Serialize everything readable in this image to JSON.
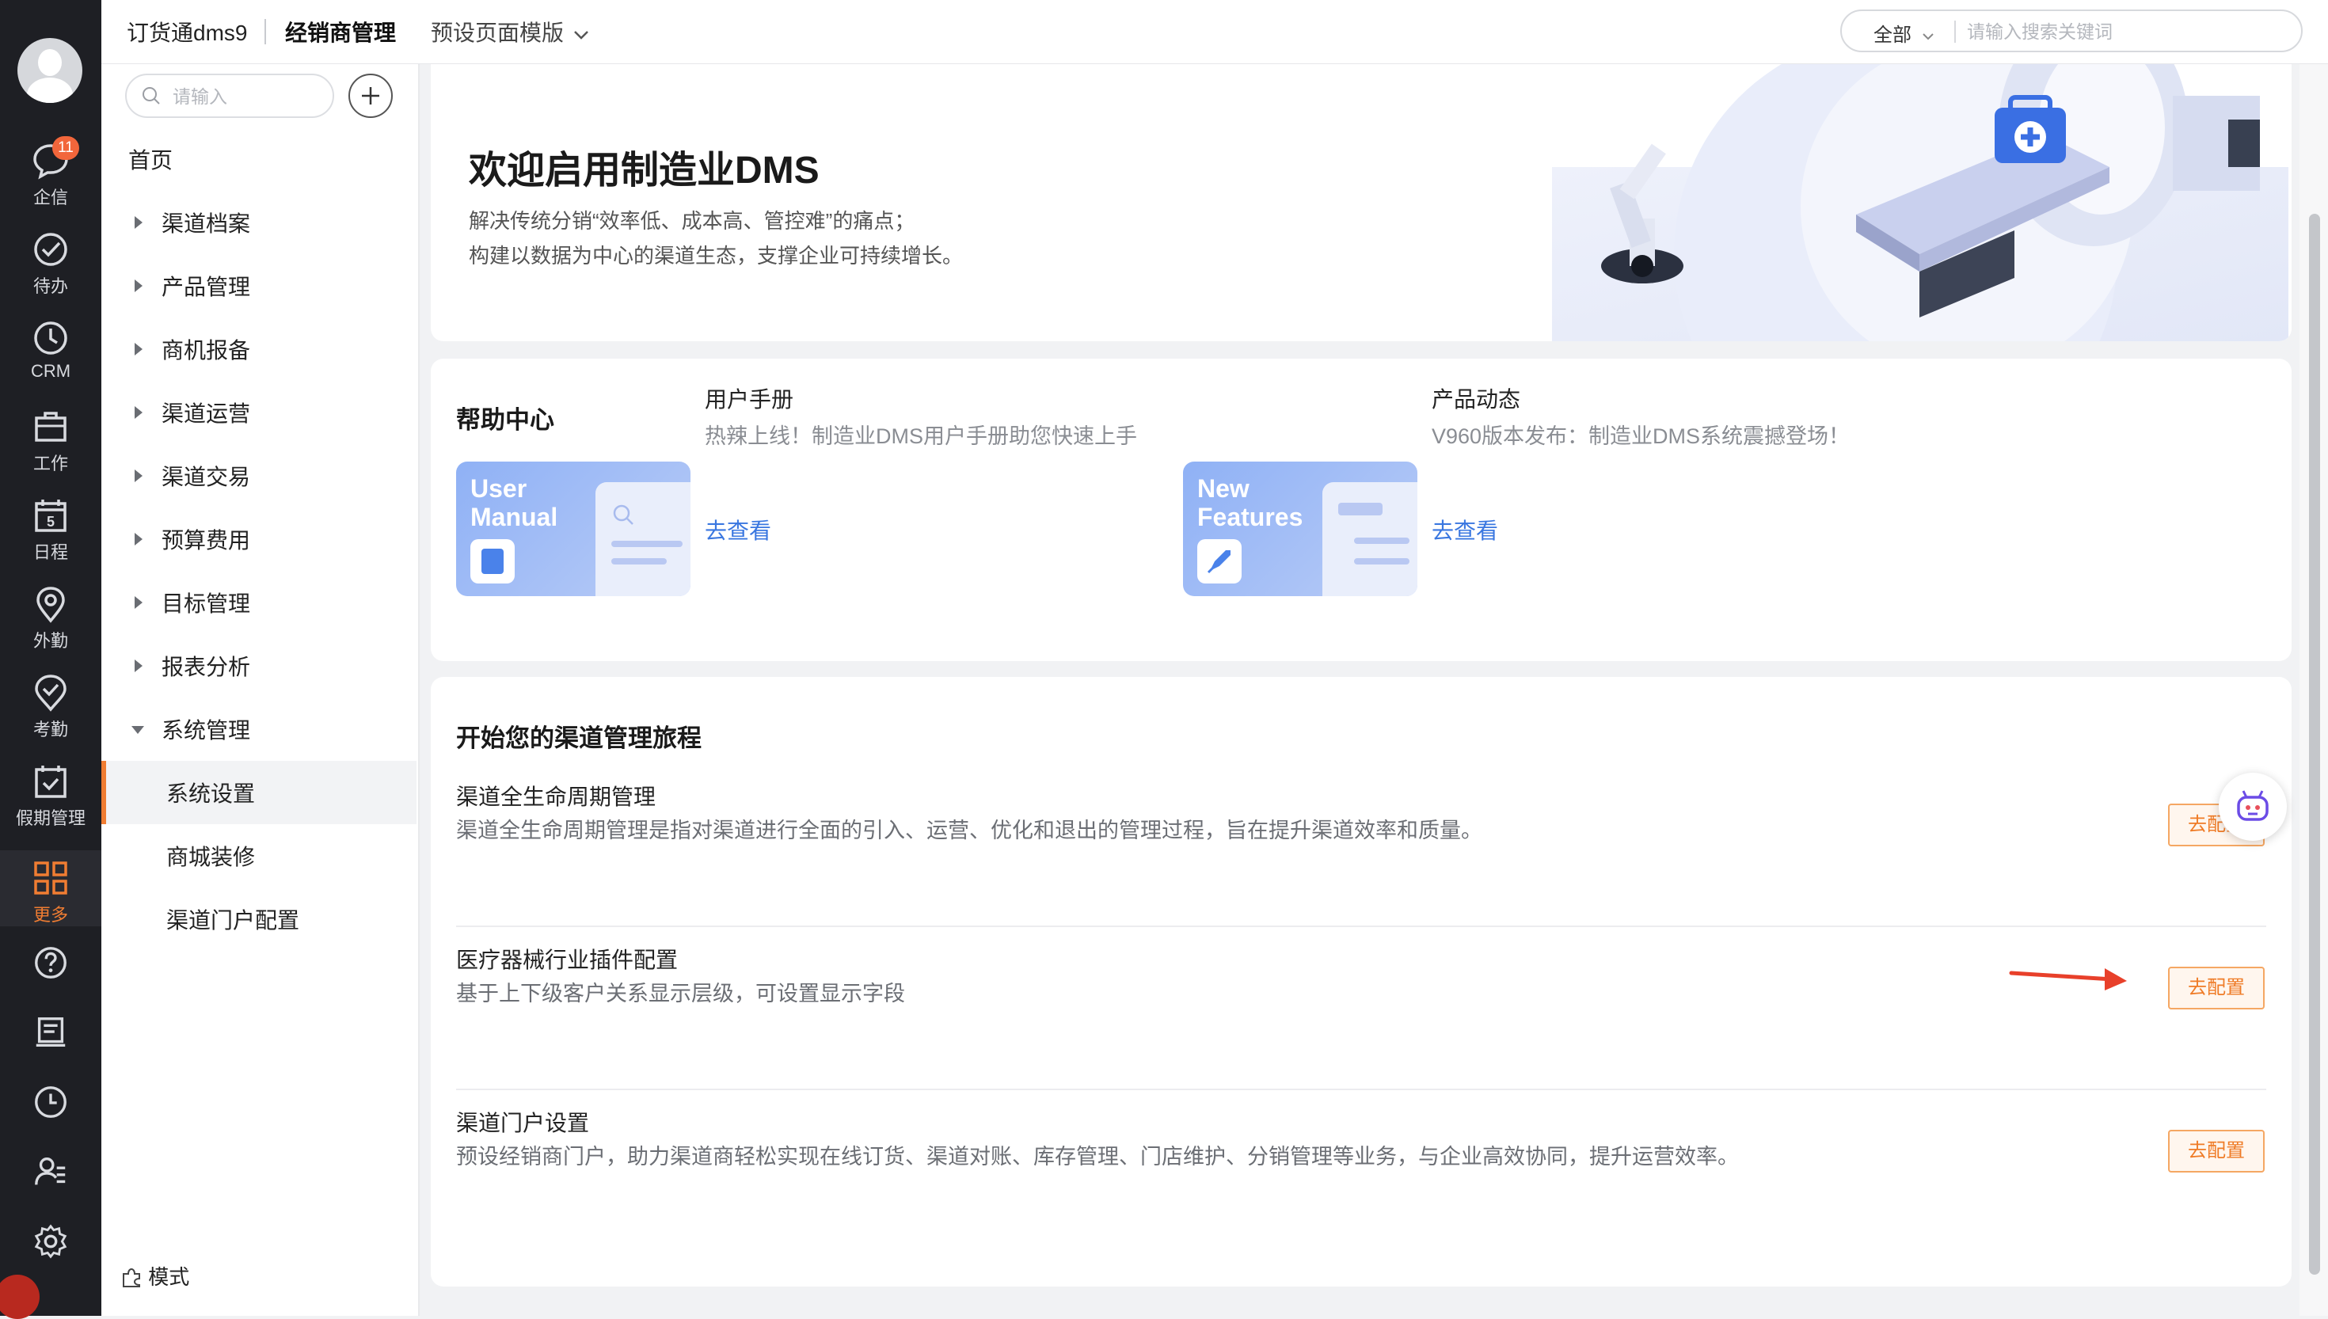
{
  "rail": {
    "items": [
      {
        "label": "企信",
        "icon": "chat-bubble-icon",
        "badge": "11"
      },
      {
        "label": "待办",
        "icon": "check-circle-icon"
      },
      {
        "label": "CRM",
        "icon": "clock-icon"
      },
      {
        "label": "工作",
        "icon": "briefcase-icon"
      },
      {
        "label": "日程",
        "icon": "calendar-icon",
        "day": "5"
      },
      {
        "label": "外勤",
        "icon": "location-pin-icon"
      },
      {
        "label": "考勤",
        "icon": "attendance-check-icon"
      },
      {
        "label": "假期管理",
        "icon": "leave-calendar-icon"
      },
      {
        "label": "更多",
        "icon": "grid-more-icon",
        "active": true
      }
    ],
    "bottom_icons": [
      "help-icon",
      "document-icon",
      "history-icon",
      "user-manage-icon",
      "settings-gear-icon"
    ]
  },
  "topbar": {
    "app_name": "订货通dms9",
    "title": "经销商管理",
    "template_label": "预设页面模版",
    "search_scope": "全部",
    "search_placeholder": "请输入搜索关键词"
  },
  "nav": {
    "search_placeholder": "请输入",
    "home": "首页",
    "groups": [
      {
        "label": "渠道档案"
      },
      {
        "label": "产品管理"
      },
      {
        "label": "商机报备"
      },
      {
        "label": "渠道运营"
      },
      {
        "label": "渠道交易"
      },
      {
        "label": "预算费用"
      },
      {
        "label": "目标管理"
      },
      {
        "label": "报表分析"
      },
      {
        "label": "系统管理",
        "expanded": true
      }
    ],
    "sub_items": [
      {
        "label": "系统设置",
        "active": true
      },
      {
        "label": "商城装修"
      },
      {
        "label": "渠道门户配置"
      }
    ],
    "mode_label": "模式"
  },
  "banner": {
    "title": "欢迎启用制造业DMS",
    "line1": "解决传统分销“效率低、成本高、管控难”的痛点；",
    "line2": "构建以数据为中心的渠道生态，支撑企业可持续增长。"
  },
  "help_center": {
    "title": "帮助中心",
    "cards": [
      {
        "thumb_line1": "User",
        "thumb_line2": "Manual",
        "name": "用户手册",
        "desc": "热辣上线！制造业DMS用户手册助您快速上手",
        "link": "去查看"
      },
      {
        "thumb_line1": "New",
        "thumb_line2": "Features",
        "name": "产品动态",
        "desc": "V960版本发布：制造业DMS系统震撼登场！",
        "link": "去查看"
      }
    ]
  },
  "journey": {
    "title": "开始您的渠道管理旅程",
    "rows": [
      {
        "name": "渠道全生命周期管理",
        "desc": "渠道全生命周期管理是指对渠道进行全面的引入、运营、优化和退出的管理过程，旨在提升渠道效率和质量。",
        "button": "去配置"
      },
      {
        "name": "医疗器械行业插件配置",
        "desc": "基于上下级客户关系显示层级，可设置显示字段",
        "button": "去配置"
      },
      {
        "name": "渠道门户设置",
        "desc": "预设经销商门户，助力渠道商轻松实现在线订货、渠道对账、库存管理、门店维护、分销管理等业务，与企业高效协同，提升运营效率。",
        "button": "去配置"
      }
    ]
  },
  "colors": {
    "accent": "#f07d32",
    "link": "#3a77e0",
    "rail_bg": "#1e1f24",
    "annotation_arrow": "#e8402a"
  }
}
